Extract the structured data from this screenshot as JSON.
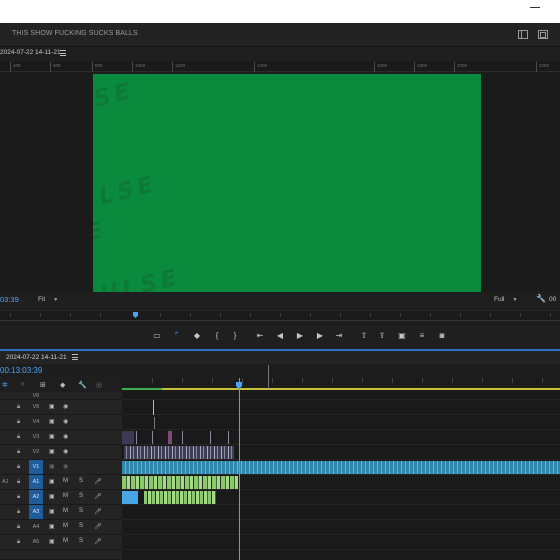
{
  "program_monitor": {
    "title": "THIS SHOW FUCKING SUCKS BALLS",
    "sequence_name": "2024-07-22 14-11-21",
    "ruler_labels": [
      "400",
      "600",
      "800",
      "1000",
      "1200",
      "1400",
      "1600",
      "1800",
      "2000",
      "2200"
    ],
    "watermark_text": "UNIPULSE",
    "timecode": "03:39",
    "fit_value": "Fit",
    "quality_value": "Full",
    "duration_timecode": "00"
  },
  "timeline": {
    "sequence_name": "2024-07-22 14-11-21",
    "timecode": "00:13:03:39",
    "video_tracks": [
      {
        "name": "V6",
        "source": "",
        "selected": false
      },
      {
        "name": "V5",
        "source": "",
        "selected": false
      },
      {
        "name": "V4",
        "source": "",
        "selected": false
      },
      {
        "name": "V3",
        "source": "",
        "selected": false
      },
      {
        "name": "V2",
        "source": "",
        "selected": false
      },
      {
        "name": "V1",
        "source": "V1",
        "selected": true
      }
    ],
    "audio_tracks": [
      {
        "name": "A1",
        "source": "A1",
        "selected": true
      },
      {
        "name": "A2",
        "source": "",
        "selected": true
      },
      {
        "name": "A3",
        "source": "",
        "selected": true
      },
      {
        "name": "A4",
        "source": "",
        "selected": false
      },
      {
        "name": "A5",
        "source": "",
        "selected": false
      }
    ],
    "mute_label": "M",
    "solo_label": "S"
  },
  "colors": {
    "accent": "#4aa3ff",
    "frame_green": "#0a8a3c",
    "audio_clip": "#8cc86e",
    "video_clip": "#2f8fb5"
  }
}
